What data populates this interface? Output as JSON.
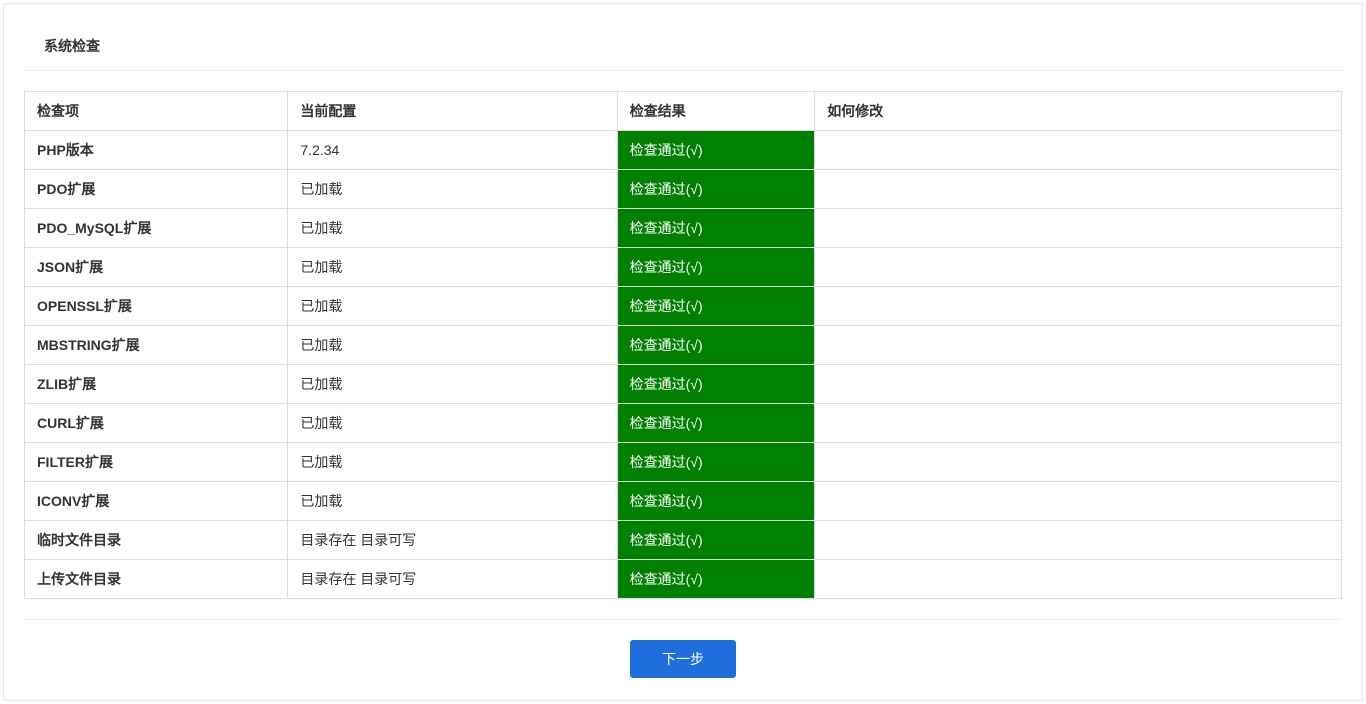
{
  "panel_title": "系统检查",
  "columns": {
    "item": "检查项",
    "config": "当前配置",
    "result": "检查结果",
    "howto": "如何修改"
  },
  "rows": [
    {
      "item": "PHP版本",
      "config": "7.2.34",
      "result": "检查通过(√)",
      "howto": ""
    },
    {
      "item": "PDO扩展",
      "config": "已加载",
      "result": "检查通过(√)",
      "howto": ""
    },
    {
      "item": "PDO_MySQL扩展",
      "config": "已加载",
      "result": "检查通过(√)",
      "howto": ""
    },
    {
      "item": "JSON扩展",
      "config": "已加载",
      "result": "检查通过(√)",
      "howto": ""
    },
    {
      "item": "OPENSSL扩展",
      "config": "已加载",
      "result": "检查通过(√)",
      "howto": ""
    },
    {
      "item": "MBSTRING扩展",
      "config": "已加载",
      "result": "检查通过(√)",
      "howto": ""
    },
    {
      "item": "ZLIB扩展",
      "config": "已加载",
      "result": "检查通过(√)",
      "howto": ""
    },
    {
      "item": "CURL扩展",
      "config": "已加载",
      "result": "检查通过(√)",
      "howto": ""
    },
    {
      "item": "FILTER扩展",
      "config": "已加载",
      "result": "检查通过(√)",
      "howto": ""
    },
    {
      "item": "ICONV扩展",
      "config": "已加载",
      "result": "检查通过(√)",
      "howto": ""
    },
    {
      "item": "临时文件目录",
      "config": "目录存在 目录可写",
      "result": "检查通过(√)",
      "howto": ""
    },
    {
      "item": "上传文件目录",
      "config": "目录存在 目录可写",
      "result": "检查通过(√)",
      "howto": ""
    }
  ],
  "next_button": "下一步"
}
